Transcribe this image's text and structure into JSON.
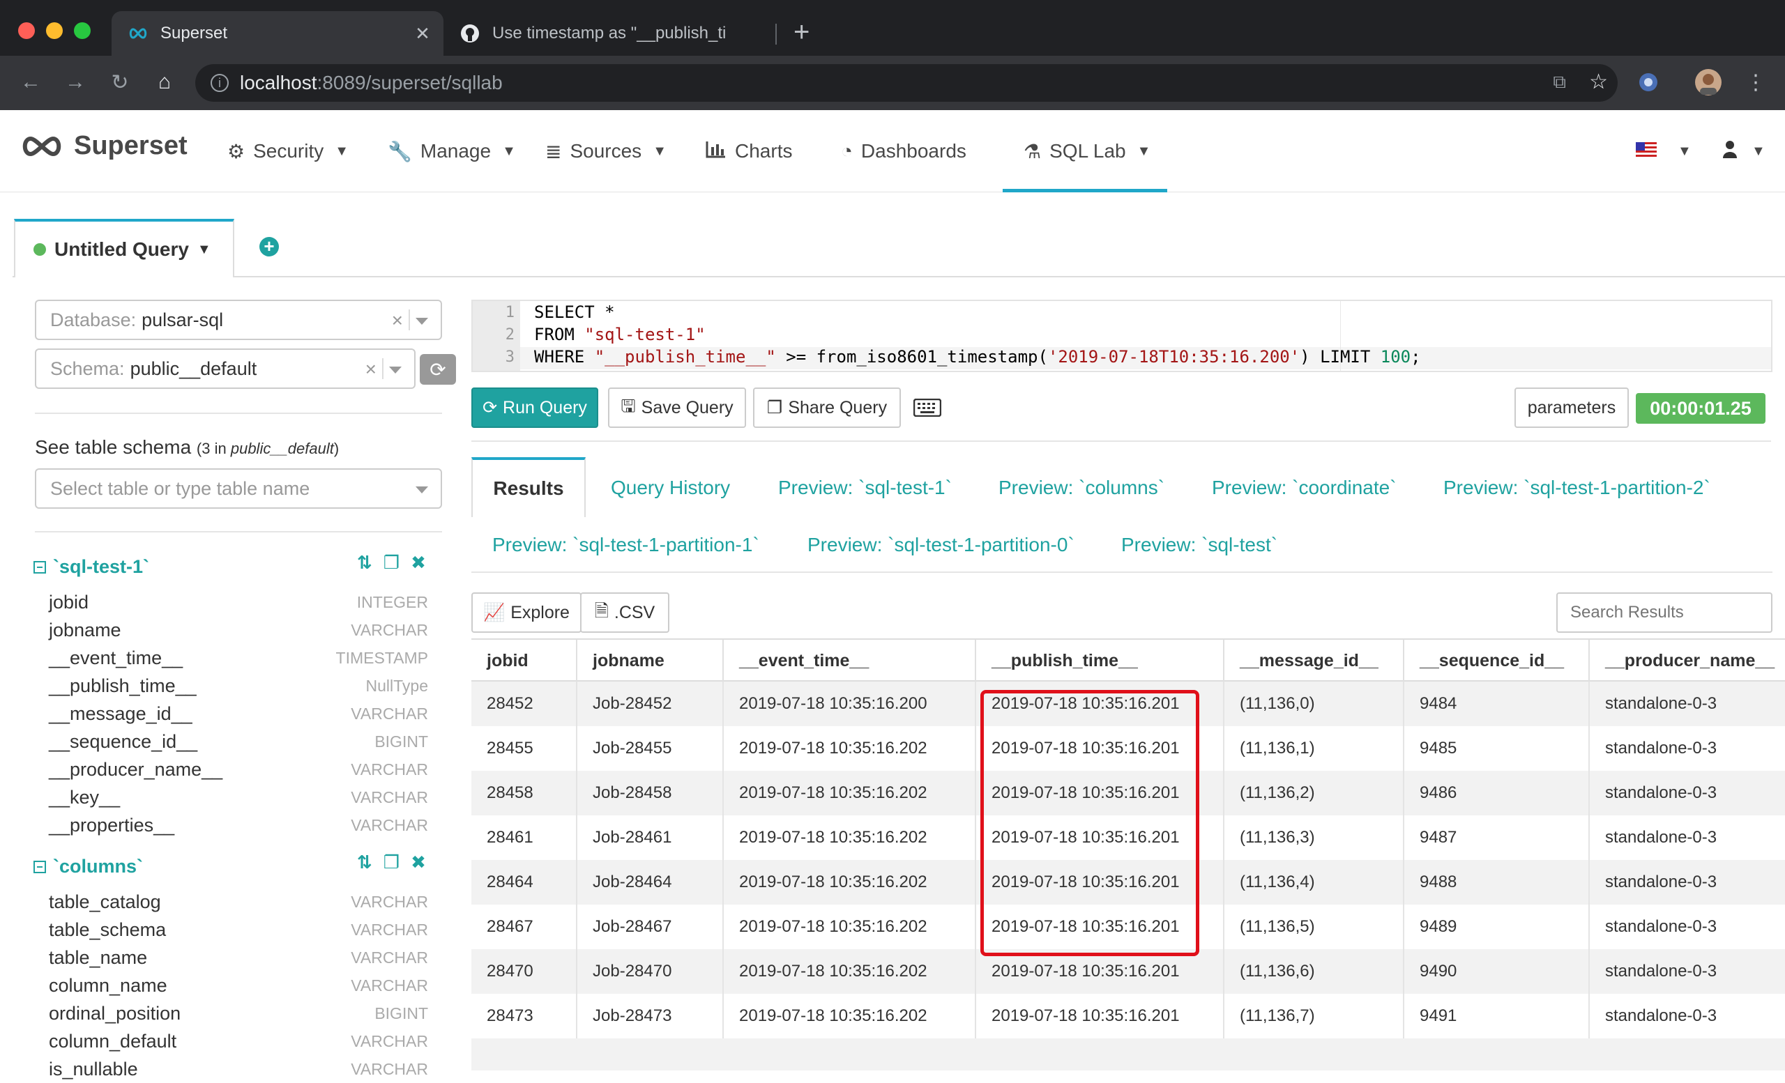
{
  "browser": {
    "tabs": [
      {
        "title": "Superset",
        "active": true
      },
      {
        "title": "Use timestamp as \"__publish_ti",
        "active": false
      }
    ],
    "url_host": "localhost",
    "url_rest": ":8089/superset/sqllab"
  },
  "navbar": {
    "brand": "Superset",
    "items": [
      {
        "label": "Security",
        "icon": "cogs-icon",
        "dropdown": true
      },
      {
        "label": "Manage",
        "icon": "wrench-icon",
        "dropdown": true
      },
      {
        "label": "Sources",
        "icon": "database-icon",
        "dropdown": true
      },
      {
        "label": "Charts",
        "icon": "bar-chart-icon",
        "dropdown": false
      },
      {
        "label": "Dashboards",
        "icon": "dashboard-icon",
        "dropdown": false
      },
      {
        "label": "SQL Lab",
        "icon": "flask-icon",
        "dropdown": true
      }
    ]
  },
  "query_tab": {
    "label": "Untitled Query"
  },
  "left": {
    "database_label": "Database:",
    "database_value": "pulsar-sql",
    "schema_label": "Schema:",
    "schema_value": "public__default",
    "schema_title": "See table schema",
    "schema_count_prefix": "(3 in ",
    "schema_count_schema": "public__default",
    "schema_count_suffix": ")",
    "table_placeholder": "Select table or type table name",
    "tables": [
      {
        "name": "`sql-test-1`",
        "columns": [
          {
            "name": "jobid",
            "type": "INTEGER"
          },
          {
            "name": "jobname",
            "type": "VARCHAR"
          },
          {
            "name": "__event_time__",
            "type": "TIMESTAMP"
          },
          {
            "name": "__publish_time__",
            "type": "NullType"
          },
          {
            "name": "__message_id__",
            "type": "VARCHAR"
          },
          {
            "name": "__sequence_id__",
            "type": "BIGINT"
          },
          {
            "name": "__producer_name__",
            "type": "VARCHAR"
          },
          {
            "name": "__key__",
            "type": "VARCHAR"
          },
          {
            "name": "__properties__",
            "type": "VARCHAR"
          }
        ]
      },
      {
        "name": "`columns`",
        "columns": [
          {
            "name": "table_catalog",
            "type": "VARCHAR"
          },
          {
            "name": "table_schema",
            "type": "VARCHAR"
          },
          {
            "name": "table_name",
            "type": "VARCHAR"
          },
          {
            "name": "column_name",
            "type": "VARCHAR"
          },
          {
            "name": "ordinal_position",
            "type": "BIGINT"
          },
          {
            "name": "column_default",
            "type": "VARCHAR"
          },
          {
            "name": "is_nullable",
            "type": "VARCHAR"
          }
        ]
      }
    ]
  },
  "editor": {
    "line1": "SELECT *",
    "line2_kw": "FROM ",
    "line2_str": "\"sql-test-1\"",
    "line3_kw": "WHERE ",
    "line3_col": "\"__publish_time__\"",
    "line3_op": " >= from_iso8601_timestamp(",
    "line3_ts": "'2019-07-18T10:35:16.200'",
    "line3_limit": ") LIMIT ",
    "line3_num": "100",
    "line3_end": ";"
  },
  "actions": {
    "run": "Run Query",
    "save": "Save Query",
    "share": "Share Query",
    "parameters": "parameters",
    "timer": "00:00:01.25"
  },
  "result_tabs": [
    "Results",
    "Query History",
    "Preview: `sql-test-1`",
    "Preview: `columns`",
    "Preview: `coordinate`",
    "Preview: `sql-test-1-partition-2`",
    "Preview: `sql-test-1-partition-1`",
    "Preview: `sql-test-1-partition-0`",
    "Preview: `sql-test`"
  ],
  "results": {
    "explore": "Explore",
    "csv": ".CSV",
    "search_placeholder": "Search Results",
    "columns": [
      "jobid",
      "jobname",
      "__event_time__",
      "__publish_time__",
      "__message_id__",
      "__sequence_id__",
      "__producer_name__"
    ],
    "rows": [
      [
        "28452",
        "Job-28452",
        "2019-07-18 10:35:16.200",
        "2019-07-18 10:35:16.201",
        "(11,136,0)",
        "9484",
        "standalone-0-3"
      ],
      [
        "28455",
        "Job-28455",
        "2019-07-18 10:35:16.202",
        "2019-07-18 10:35:16.201",
        "(11,136,1)",
        "9485",
        "standalone-0-3"
      ],
      [
        "28458",
        "Job-28458",
        "2019-07-18 10:35:16.202",
        "2019-07-18 10:35:16.201",
        "(11,136,2)",
        "9486",
        "standalone-0-3"
      ],
      [
        "28461",
        "Job-28461",
        "2019-07-18 10:35:16.202",
        "2019-07-18 10:35:16.201",
        "(11,136,3)",
        "9487",
        "standalone-0-3"
      ],
      [
        "28464",
        "Job-28464",
        "2019-07-18 10:35:16.202",
        "2019-07-18 10:35:16.201",
        "(11,136,4)",
        "9488",
        "standalone-0-3"
      ],
      [
        "28467",
        "Job-28467",
        "2019-07-18 10:35:16.202",
        "2019-07-18 10:35:16.201",
        "(11,136,5)",
        "9489",
        "standalone-0-3"
      ],
      [
        "28470",
        "Job-28470",
        "2019-07-18 10:35:16.202",
        "2019-07-18 10:35:16.201",
        "(11,136,6)",
        "9490",
        "standalone-0-3"
      ],
      [
        "28473",
        "Job-28473",
        "2019-07-18 10:35:16.202",
        "2019-07-18 10:35:16.201",
        "(11,136,7)",
        "9491",
        "standalone-0-3"
      ]
    ]
  },
  "colors": {
    "accent": "#1fa2a0",
    "nav_underline": "#20a7c9",
    "timer": "#5cb85c",
    "highlight": "#e0101a"
  }
}
